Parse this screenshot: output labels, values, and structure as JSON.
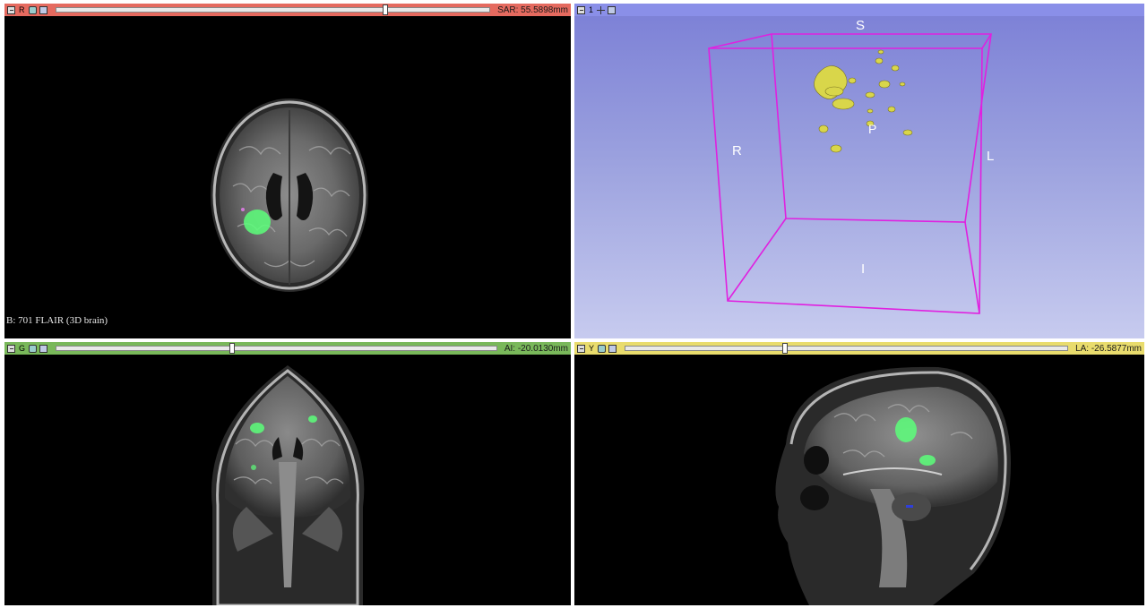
{
  "views": {
    "red": {
      "letter": "R",
      "readout": "SAR: 55.5898mm",
      "slider_fraction": 0.76,
      "caption": "B: 701 FLAIR (3D brain)",
      "bar_color": "#e56a5f"
    },
    "threed": {
      "letter": "1",
      "bar_color": "#8a8fe8",
      "orientation": {
        "superior": "S",
        "posterior": "P",
        "right": "R",
        "left": "L",
        "inferior": "I"
      }
    },
    "green": {
      "letter": "G",
      "readout": "AI: -20.0130mm",
      "slider_fraction": 0.4,
      "bar_color": "#79b85a"
    },
    "yellow": {
      "letter": "Y",
      "readout": "LA: -26.5877mm",
      "slider_fraction": 0.36,
      "bar_color": "#e9dc6d"
    }
  },
  "colors": {
    "lesion_segmentation": "#5cff7a",
    "lesion_3d_model": "#d9d64a",
    "bounding_box": "#e020e0",
    "background_3d_top": "#7b7fd6",
    "background_3d_bottom": "#c7cbef"
  }
}
